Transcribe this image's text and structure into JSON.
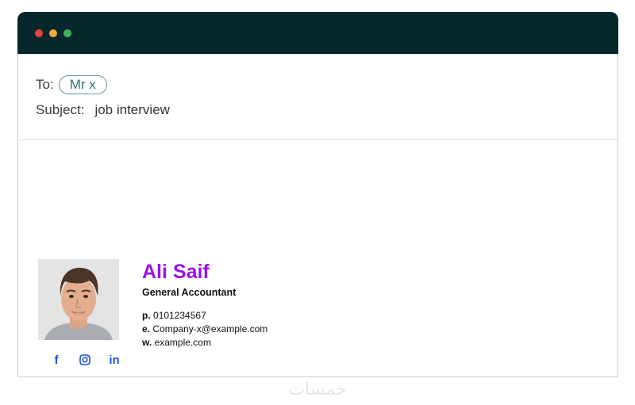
{
  "window": {
    "titlebar_color": "#06272b",
    "dots": [
      {
        "name": "close",
        "color": "#e8453c"
      },
      {
        "name": "minimize",
        "color": "#f1a935"
      },
      {
        "name": "maximize",
        "color": "#3fb55a"
      }
    ]
  },
  "email": {
    "to_label": "To:",
    "recipient": "Mr x",
    "subject_label": "Subject:",
    "subject_value": "job interview"
  },
  "signature": {
    "name": "Ali Saif",
    "name_color": "#9b12e8",
    "job_title": "General Accountant",
    "phone_label": "p.",
    "phone": "0101234567",
    "email_label": "e.",
    "email": "Company-x@example.com",
    "website_label": "w.",
    "website": "example.com",
    "social": [
      {
        "icon": "facebook-icon",
        "glyph": "f"
      },
      {
        "icon": "instagram-icon"
      },
      {
        "icon": "linkedin-icon",
        "glyph": "in"
      }
    ],
    "social_color": "#1a53e0"
  },
  "watermark": {
    "text": "خمسات"
  }
}
